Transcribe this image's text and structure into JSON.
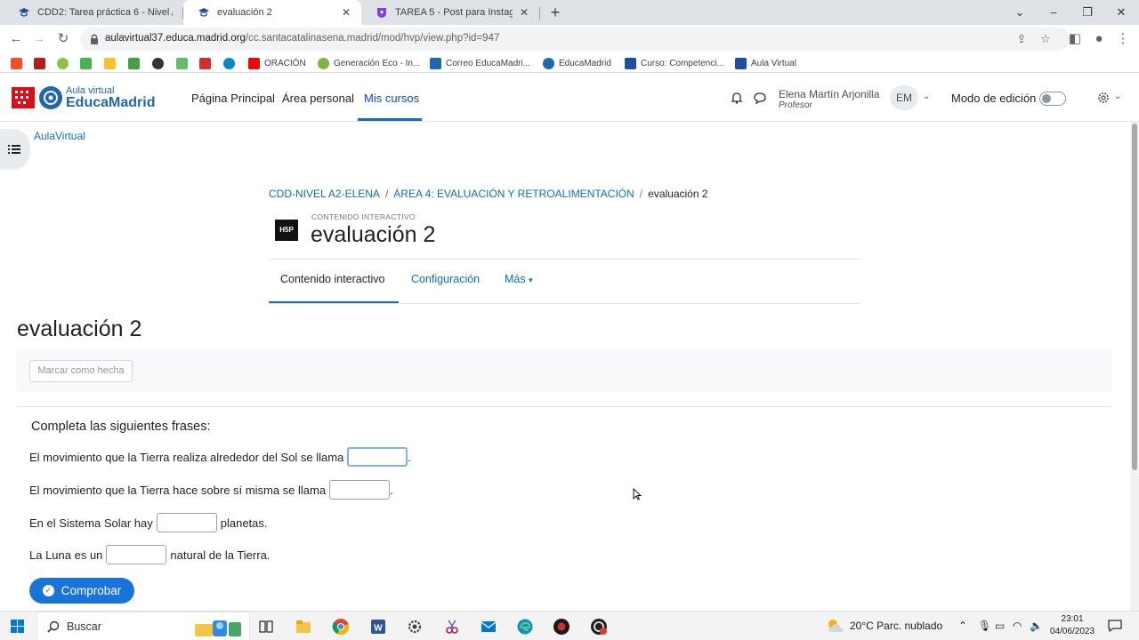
{
  "browser": {
    "tabs": [
      {
        "label": "CDD2: Tarea práctica 6 - Nivel A2",
        "active": false
      },
      {
        "label": "evaluación 2",
        "active": true
      },
      {
        "label": "TAREA 5 - Post para Instagram",
        "active": false
      }
    ],
    "url_host": "aulavirtual37.educa.madrid.org",
    "url_path": "/cc.santacatalinasena.madrid/mod/hvp/view.php?id=947",
    "bookmarks": [
      {
        "label": "ORACIÓN",
        "color": "#ff0000"
      },
      {
        "label": "Generación Eco - In...",
        "color": "#7cb342"
      },
      {
        "label": "Correo EducaMadri...",
        "color": "#1f66b2"
      },
      {
        "label": "EducaMadrid",
        "color": "#1f66b2"
      },
      {
        "label": "Curso: Competenci...",
        "color": "#1f4e9c"
      },
      {
        "label": "Aula Virtual",
        "color": "#1f4e9c"
      }
    ]
  },
  "moodle": {
    "logo_small": "Aula virtual",
    "logo_big": "EducaMadrid",
    "nav": [
      "Página Principal",
      "Área personal",
      "Mis cursos"
    ],
    "user_name": "Elena Martín Arjonilla",
    "user_role": "Profesor",
    "user_initials": "EM",
    "edit_mode_label": "Modo de edición",
    "aula_link": "AulaVirtual"
  },
  "page": {
    "breadcrumb": [
      "CDD-NIVEL A2-ELENA",
      "ÁREA 4: EVALUACIÓN Y RETROALIMENTACIÓN",
      "evaluación 2"
    ],
    "module_type": "CONTENIDO INTERACTIVO",
    "title": "evaluación 2",
    "secondary_nav": [
      "Contenido interactivo",
      "Configuración",
      "Más"
    ],
    "heading": "evaluación 2",
    "mark_done": "Marcar como hecha"
  },
  "h5p": {
    "intro": "Completa las siguientes frases:",
    "q1_before": "El movimiento que la Tierra realiza alrededor del Sol se llama",
    "q1_after": ".",
    "q2_before": "El movimiento que la Tierra hace sobre sí misma se llama",
    "q2_after": ".",
    "q3_before": "En el Sistema Solar hay",
    "q3_after": "planetas.",
    "q4_before": "La Luna es un",
    "q4_after": "natural de la Tierra.",
    "check_label": "Comprobar"
  },
  "taskbar": {
    "search_label": "Buscar",
    "weather": "20°C  Parc. nublado",
    "time": "23:01",
    "date": "04/06/2023"
  }
}
